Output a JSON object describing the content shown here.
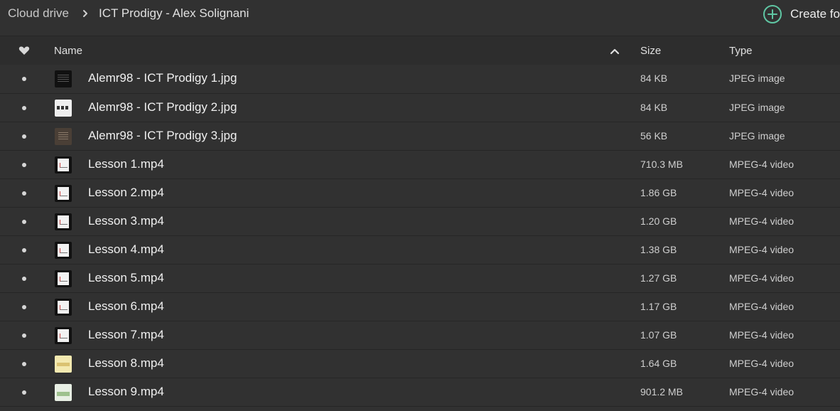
{
  "breadcrumb": {
    "root": "Cloud drive",
    "current": "ICT Prodigy - Alex Solignani"
  },
  "actions": {
    "create_label": "Create fo",
    "create_icon": "plus-circle-icon",
    "create_color": "#5fc6a3"
  },
  "table": {
    "headers": {
      "favorite_icon": "heart-icon",
      "name": "Name",
      "sort_icon": "chevron-up-icon",
      "size": "Size",
      "type": "Type"
    },
    "rows": [
      {
        "name": "Alemr98 - ICT Prodigy 1.jpg",
        "size": "84 KB",
        "type": "JPEG image",
        "thumb": "jpg-dark"
      },
      {
        "name": "Alemr98 - ICT Prodigy 2.jpg",
        "size": "84 KB",
        "type": "JPEG image",
        "thumb": "jpg-light"
      },
      {
        "name": "Alemr98 - ICT Prodigy 3.jpg",
        "size": "56 KB",
        "type": "JPEG image",
        "thumb": "jpg-brown"
      },
      {
        "name": "Lesson 1.mp4",
        "size": "710.3 MB",
        "type": "MPEG-4 video",
        "thumb": "vid"
      },
      {
        "name": "Lesson 2.mp4",
        "size": "1.86 GB",
        "type": "MPEG-4 video",
        "thumb": "vid"
      },
      {
        "name": "Lesson 3.mp4",
        "size": "1.20 GB",
        "type": "MPEG-4 video",
        "thumb": "vid"
      },
      {
        "name": "Lesson 4.mp4",
        "size": "1.38 GB",
        "type": "MPEG-4 video",
        "thumb": "vid"
      },
      {
        "name": "Lesson 5.mp4",
        "size": "1.27 GB",
        "type": "MPEG-4 video",
        "thumb": "vid"
      },
      {
        "name": "Lesson 6.mp4",
        "size": "1.17 GB",
        "type": "MPEG-4 video",
        "thumb": "vid"
      },
      {
        "name": "Lesson 7.mp4",
        "size": "1.07 GB",
        "type": "MPEG-4 video",
        "thumb": "vid"
      },
      {
        "name": "Lesson 8.mp4",
        "size": "1.64 GB",
        "type": "MPEG-4 video",
        "thumb": "vid-pale"
      },
      {
        "name": "Lesson 9.mp4",
        "size": "901.2 MB",
        "type": "MPEG-4 video",
        "thumb": "vid-green"
      }
    ]
  }
}
